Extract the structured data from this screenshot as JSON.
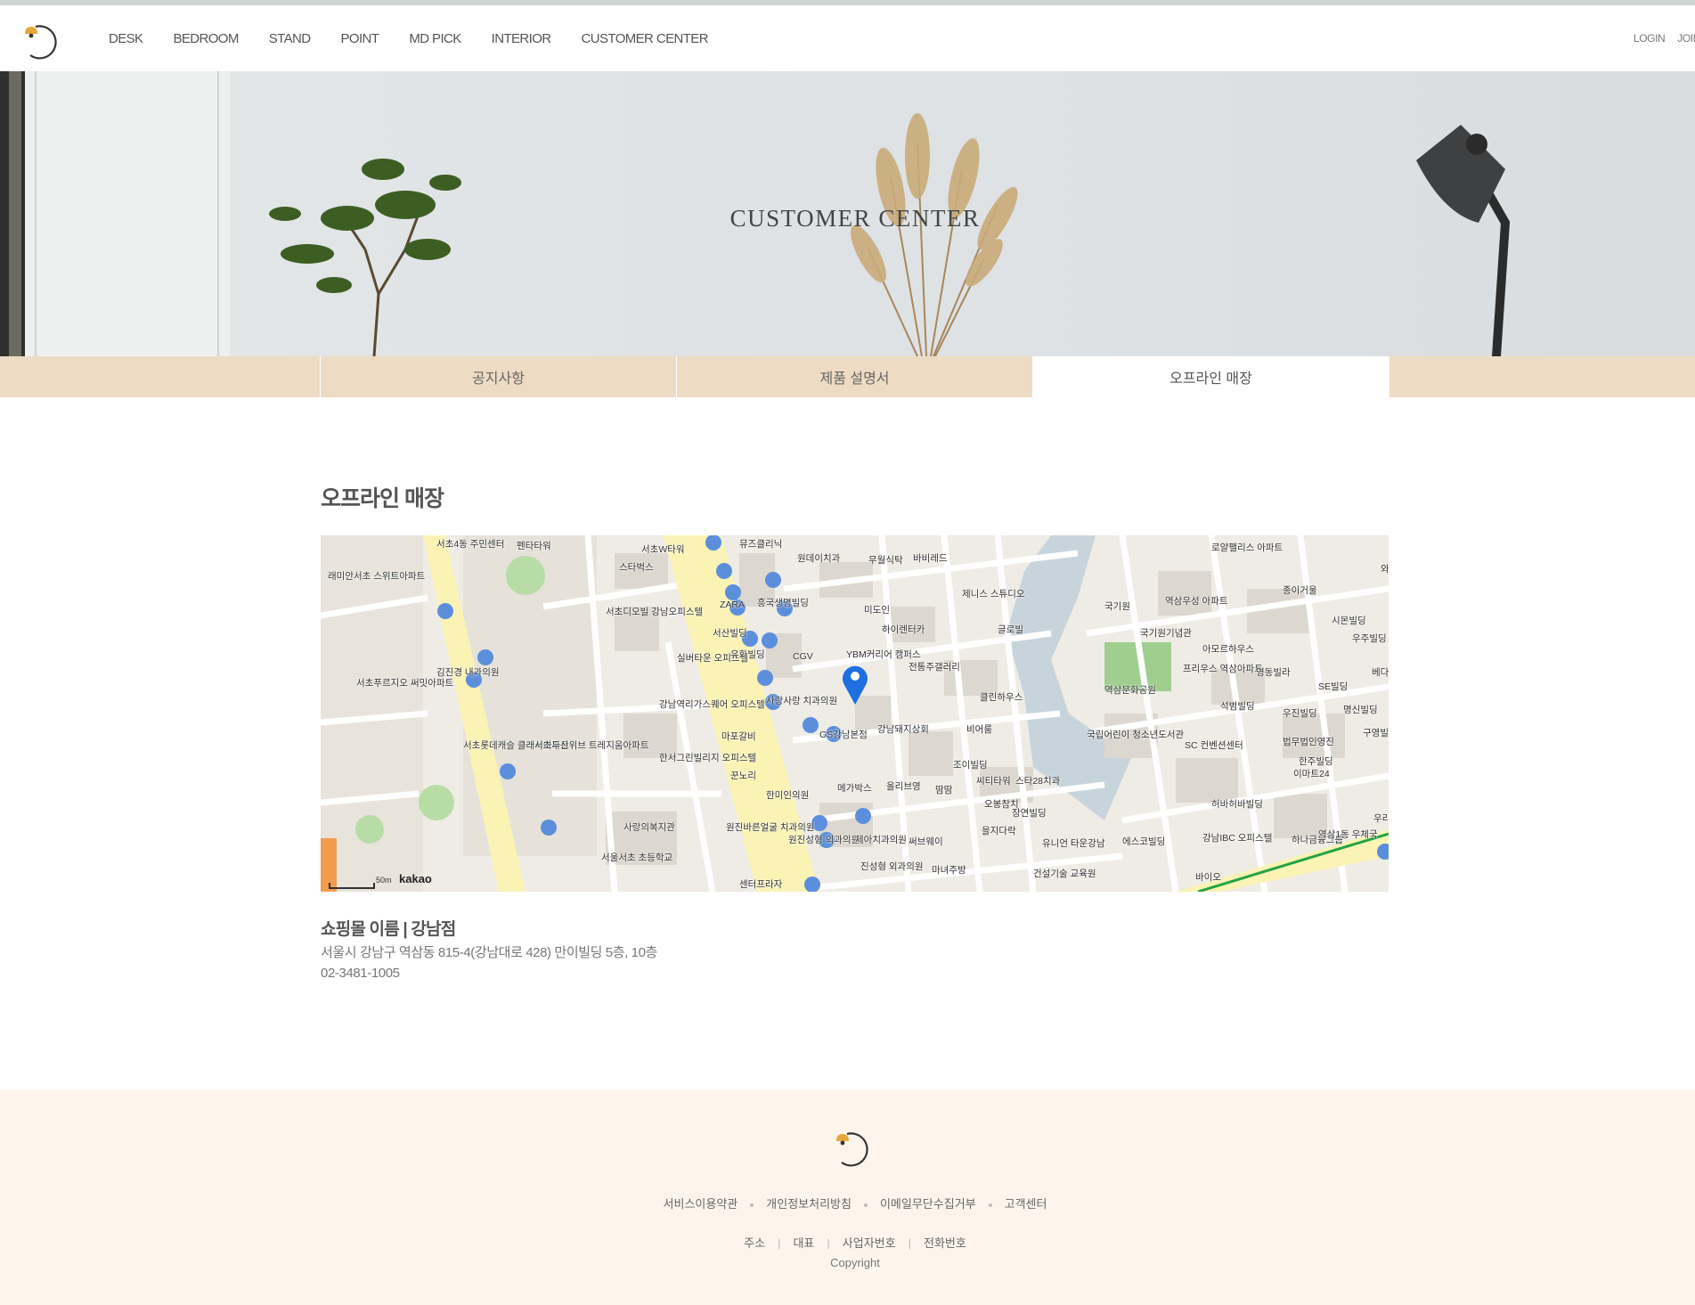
{
  "nav": {
    "items": [
      "DESK",
      "BEDROOM",
      "STAND",
      "POINT",
      "MD PICK",
      "INTERIOR",
      "CUSTOMER CENTER"
    ],
    "login": "LOGIN",
    "join": "JOIN"
  },
  "hero": {
    "title": "CUSTOMER CENTER"
  },
  "tabs": [
    {
      "label": "공지사항",
      "active": false
    },
    {
      "label": "제품 설명서",
      "active": false
    },
    {
      "label": "오프라인 매장",
      "active": true
    }
  ],
  "content": {
    "title": "오프라인 매장",
    "store_name": "쇼핑몰 이름 | 강남점",
    "address": "서울시 강남구 역삼동 815-4(강남대로 428) 만이빌딩 5층, 10층",
    "phone": "02-3481-1005"
  },
  "map": {
    "scale": "50m",
    "brand": "kakao",
    "labels": [
      "서초4동 주민센터",
      "펜타타워",
      "서초W타워",
      "뮤즈클리닉",
      "원데이치과",
      "무월식탁",
      "바비레드",
      "래미안서초 스위트아파트",
      "스타벅스",
      "서초디오빌 강남오피스텔",
      "ZARA",
      "흥국생명빌딩",
      "미도인",
      "제니스 스튜디오",
      "하이렌터카",
      "글로빌",
      "국기원",
      "역삼우성 아파트",
      "로얄팰리스 아파트",
      "종이거울",
      "와이제이 에듀케이션",
      "서산빌딩",
      "CGV",
      "YBM커리어 캠퍼스",
      "전통주갤러리",
      "국기원기념관",
      "아모르하우스",
      "시몬빌딩",
      "우주빌딩",
      "김진경 내과의원",
      "실버타운 오피스텔",
      "유화빌딩",
      "역삼문화공원",
      "프리우스 역삼아파트",
      "영동빌라",
      "SE빌딩",
      "베다니빌딩",
      "서초푸르지오 써밋아파트",
      "사랑사랑 치과의원",
      "클린하우스",
      "석범빌딩",
      "우진빌딩",
      "명신빌딩",
      "강남역리가스퀘어 오피스텔",
      "강남돼지상회",
      "국립어린이 청소년도서관",
      "구영빌딩",
      "마포갈비",
      "GS강남본점",
      "비어룸",
      "SC 컨벤션센터",
      "법무법인영진",
      "서초롯데캐슬 클래식아파트",
      "서초두산위브 트레지움아파트",
      "한서그린빌리지 오피스텔",
      "조이빌딩",
      "이마트24",
      "한주빌딩",
      "꾼노리",
      "메가박스",
      "올리브영",
      "땀땀",
      "씨티타워",
      "스타28치과",
      "한미인의원",
      "장연빌딩",
      "오봉참치",
      "허바허바빌딩",
      "사랑의복지관",
      "원진바른얼굴 치과의원",
      "원진성형 외과의원",
      "제아치과의원",
      "써브웨이",
      "을지다락",
      "유니언 타운강남",
      "에스코빌딩",
      "강남IBC 오피스텔",
      "하나금융그룹",
      "역삼1동 우체국",
      "우리은행",
      "서울서초 초등학교",
      "마녀주방",
      "진성형 외과의원",
      "건설기술 교육원",
      "바이오",
      "센터프라자"
    ]
  },
  "footer": {
    "links": [
      "서비스이용약관",
      "개인정보처리방침",
      "이메일무단수집거부",
      "고객센터"
    ],
    "info": [
      "주소",
      "대표",
      "사업자번호",
      "전화번호"
    ],
    "copyright": "Copyright"
  },
  "colors": {
    "tab_bar": "#eedbc4",
    "footer_bg": "#fdf5ec",
    "logo_bell": "#e7a83a",
    "map_pin": "#1e6fe0"
  }
}
